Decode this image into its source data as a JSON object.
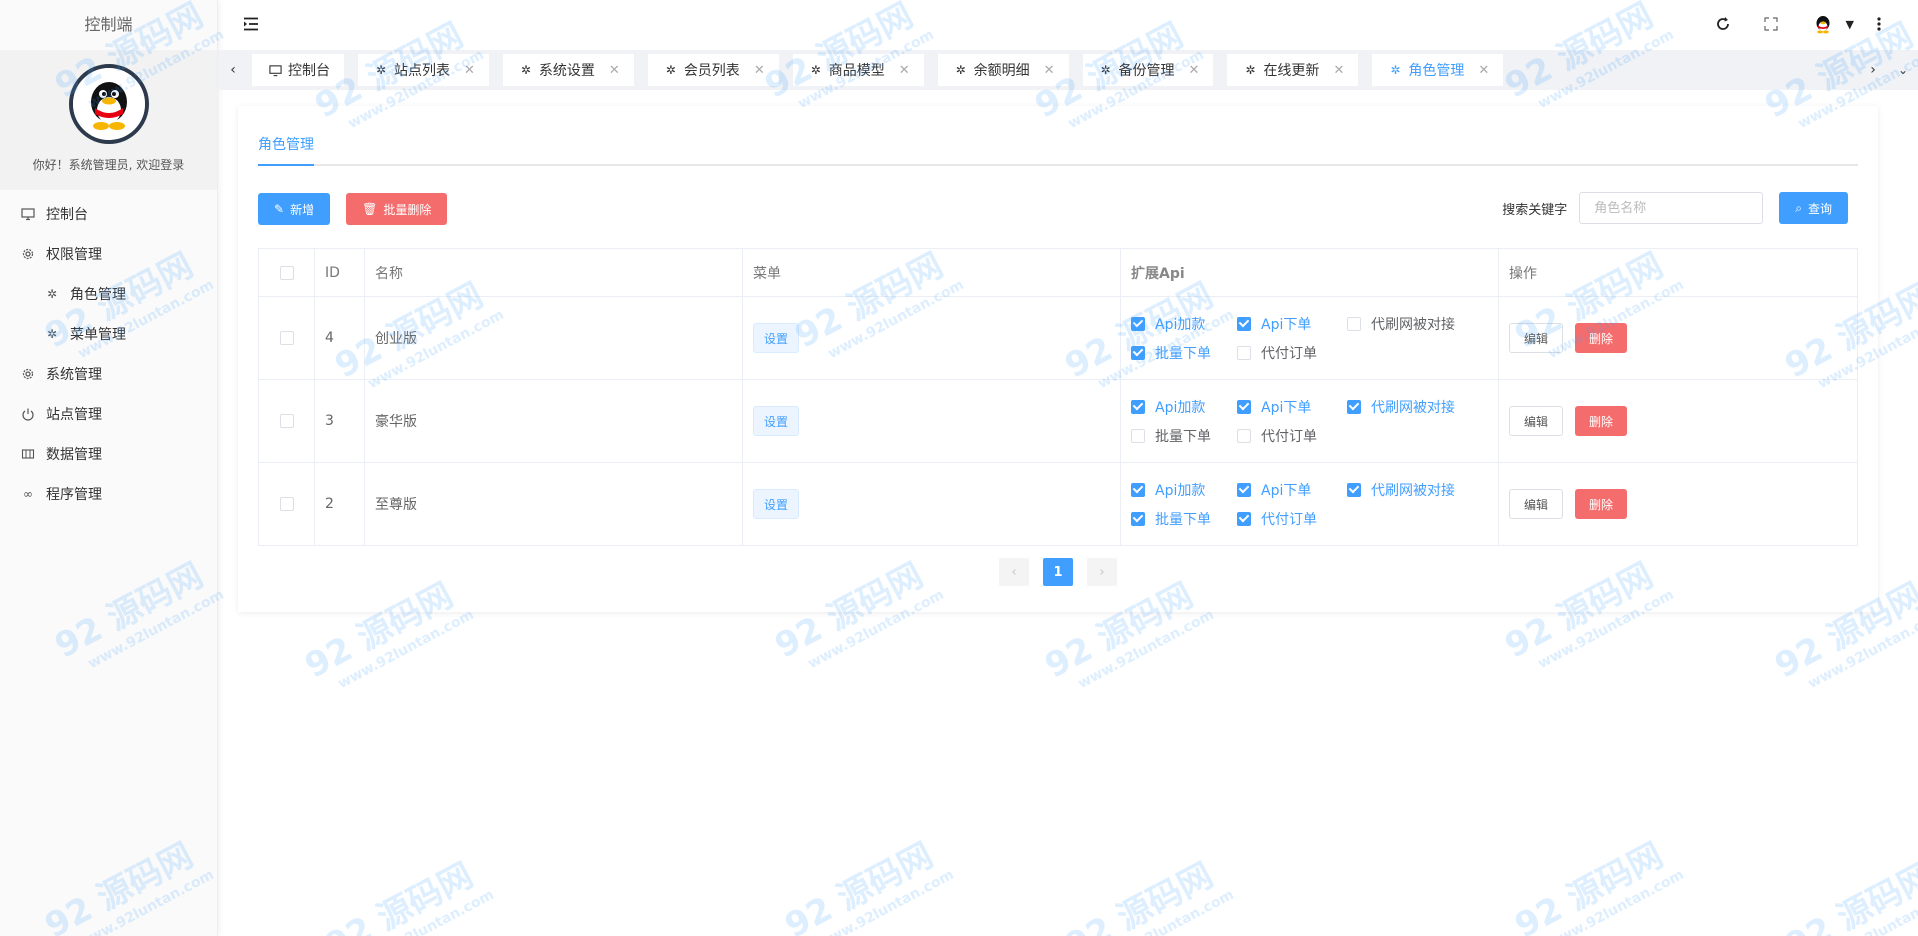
{
  "brand": "控制端",
  "profile": {
    "welcome": "你好！系统管理员, 欢迎登录"
  },
  "sidebar": {
    "items": [
      {
        "label": "控制台",
        "icon": "monitor-icon",
        "sub": false
      },
      {
        "label": "权限管理",
        "icon": "gear-icon",
        "sub": false
      },
      {
        "label": "角色管理",
        "icon": "palm-icon",
        "sub": true
      },
      {
        "label": "菜单管理",
        "icon": "palm-icon",
        "sub": true
      },
      {
        "label": "系统管理",
        "icon": "gear-icon",
        "sub": false
      },
      {
        "label": "站点管理",
        "icon": "power-icon",
        "sub": false
      },
      {
        "label": "数据管理",
        "icon": "grid-icon",
        "sub": false
      },
      {
        "label": "程序管理",
        "icon": "infinity-icon",
        "sub": false
      }
    ]
  },
  "tabs": [
    {
      "label": "控制台",
      "closable": false,
      "active": false
    },
    {
      "label": "站点列表",
      "closable": true,
      "active": false
    },
    {
      "label": "系统设置",
      "closable": true,
      "active": false
    },
    {
      "label": "会员列表",
      "closable": true,
      "active": false
    },
    {
      "label": "商品模型",
      "closable": true,
      "active": false
    },
    {
      "label": "余额明细",
      "closable": true,
      "active": false
    },
    {
      "label": "备份管理",
      "closable": true,
      "active": false
    },
    {
      "label": "在线更新",
      "closable": true,
      "active": false
    },
    {
      "label": "角色管理",
      "closable": true,
      "active": true
    }
  ],
  "page": {
    "tab_title": "角色管理",
    "add_label": "新增",
    "batch_delete_label": "批量删除",
    "search_label": "搜索关键字",
    "search_placeholder": "角色名称",
    "search_button": "查询"
  },
  "table": {
    "headers": {
      "id": "ID",
      "name": "名称",
      "menu": "菜单",
      "api": "扩展Api",
      "ops": "操作"
    },
    "set_label": "设置",
    "edit_label": "编辑",
    "delete_label": "删除",
    "rows": [
      {
        "id": "4",
        "name": "创业版",
        "api": [
          [
            {
              "label": "Api加款",
              "on": true
            },
            {
              "label": "Api下单",
              "on": true
            },
            {
              "label": "代刷网被对接",
              "on": false
            }
          ],
          [
            {
              "label": "批量下单",
              "on": true
            },
            {
              "label": "代付订单",
              "on": false
            }
          ]
        ]
      },
      {
        "id": "3",
        "name": "豪华版",
        "api": [
          [
            {
              "label": "Api加款",
              "on": true
            },
            {
              "label": "Api下单",
              "on": true
            },
            {
              "label": "代刷网被对接",
              "on": true
            }
          ],
          [
            {
              "label": "批量下单",
              "on": false
            },
            {
              "label": "代付订单",
              "on": false
            }
          ]
        ]
      },
      {
        "id": "2",
        "name": "至尊版",
        "api": [
          [
            {
              "label": "Api加款",
              "on": true
            },
            {
              "label": "Api下单",
              "on": true
            },
            {
              "label": "代刷网被对接",
              "on": true
            }
          ],
          [
            {
              "label": "批量下单",
              "on": true
            },
            {
              "label": "代付订单",
              "on": true
            }
          ]
        ]
      }
    ]
  },
  "pager": {
    "prev": "‹",
    "current": "1",
    "next": "›"
  },
  "watermark": {
    "big": "92 源码网",
    "small": "www.92luntan.com"
  },
  "colors": {
    "primary": "#409eff",
    "danger": "#f56c6c"
  }
}
